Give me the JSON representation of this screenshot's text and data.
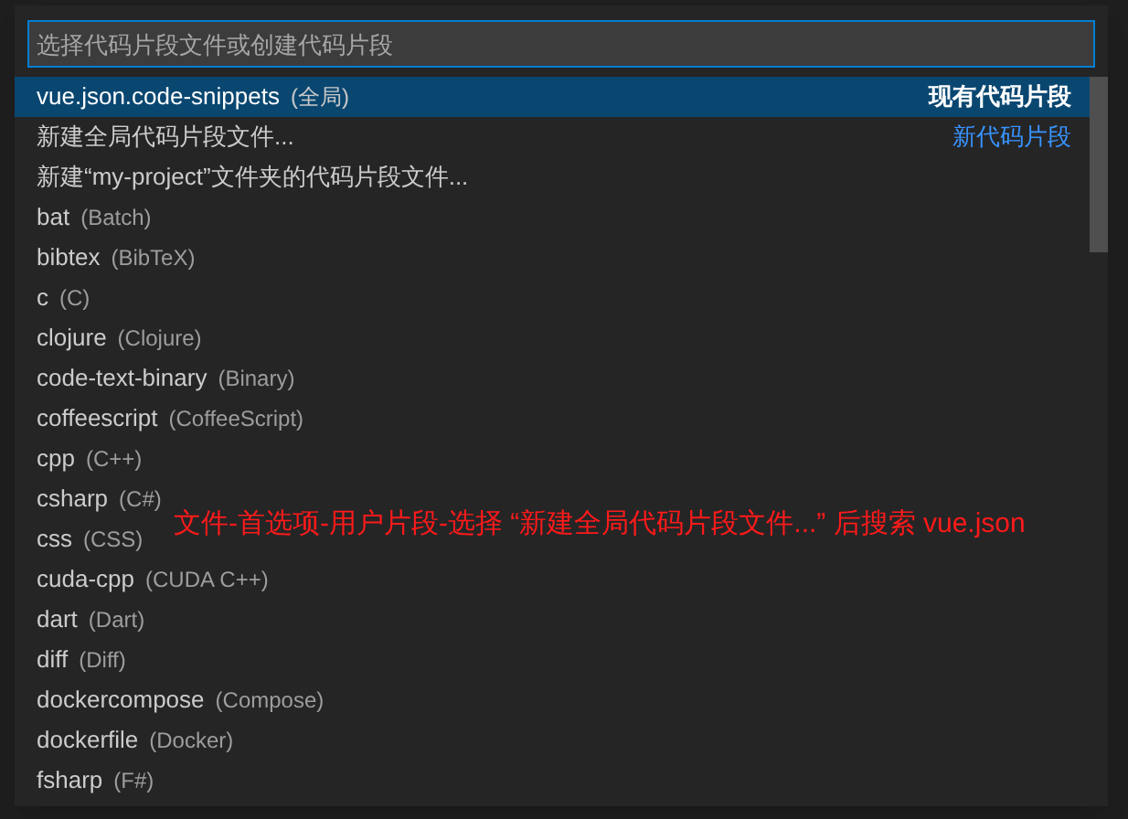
{
  "input": {
    "placeholder": "选择代码片段文件或创建代码片段"
  },
  "items": [
    {
      "label": "vue.json.code-snippets",
      "detail": "(全局)",
      "tag": "现有代码片段",
      "selected": true
    },
    {
      "label": "新建全局代码片段文件...",
      "tag": "新代码片段",
      "selected": false
    },
    {
      "label": "新建“my-project”文件夹的代码片段文件...",
      "selected": false
    },
    {
      "label": "bat",
      "detail": "(Batch)",
      "selected": false
    },
    {
      "label": "bibtex",
      "detail": "(BibTeX)",
      "selected": false
    },
    {
      "label": "c",
      "detail": "(C)",
      "selected": false
    },
    {
      "label": "clojure",
      "detail": "(Clojure)",
      "selected": false
    },
    {
      "label": "code-text-binary",
      "detail": "(Binary)",
      "selected": false
    },
    {
      "label": "coffeescript",
      "detail": "(CoffeeScript)",
      "selected": false
    },
    {
      "label": "cpp",
      "detail": "(C++)",
      "selected": false
    },
    {
      "label": "csharp",
      "detail": "(C#)",
      "selected": false
    },
    {
      "label": "css",
      "detail": "(CSS)",
      "selected": false
    },
    {
      "label": "cuda-cpp",
      "detail": "(CUDA C++)",
      "selected": false
    },
    {
      "label": "dart",
      "detail": "(Dart)",
      "selected": false
    },
    {
      "label": "diff",
      "detail": "(Diff)",
      "selected": false
    },
    {
      "label": "dockercompose",
      "detail": "(Compose)",
      "selected": false
    },
    {
      "label": "dockerfile",
      "detail": "(Docker)",
      "selected": false
    },
    {
      "label": "fsharp",
      "detail": "(F#)",
      "selected": false
    }
  ],
  "annotation": "文件-首选项-用户片段-选择 “新建全局代码片段文件...” 后搜索 vue.json"
}
